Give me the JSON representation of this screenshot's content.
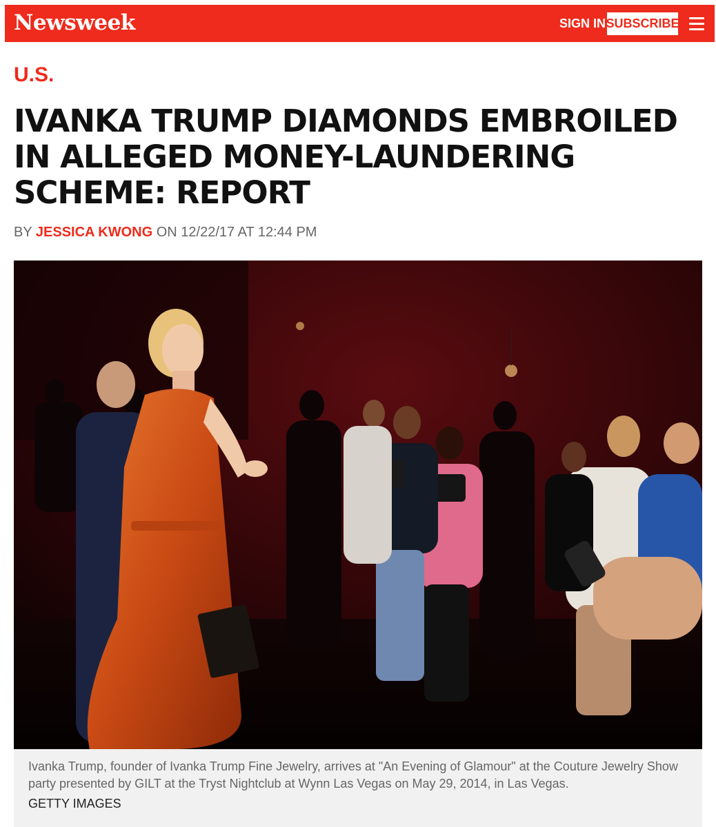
{
  "header": {
    "logo": "Newsweek",
    "sign_in": "SIGN IN",
    "subscribe": "SUBSCRIBE"
  },
  "article": {
    "section": "U.S.",
    "headline": "IVANKA TRUMP DIAMONDS EMBROILED IN ALLEGED MONEY-LAUNDERING SCHEME: REPORT",
    "byline": {
      "by": "BY",
      "author": "JESSICA KWONG",
      "on": "ON 12/22/17 AT 12:44 PM"
    },
    "caption": "Ivanka Trump, founder of Ivanka Trump Fine Jewelry, arrives at \"An Evening of Glamour\" at the Couture Jewelry Show party presented by GILT at the Tryst Nightclub at Wynn Las Vegas on May 29, 2014, in Las Vegas.",
    "credit": "GETTY IMAGES"
  },
  "colors": {
    "brand_red": "#ee2b1c",
    "caption_bg": "#f1f1f1"
  },
  "icons": {
    "menu": "hamburger-menu-icon"
  }
}
